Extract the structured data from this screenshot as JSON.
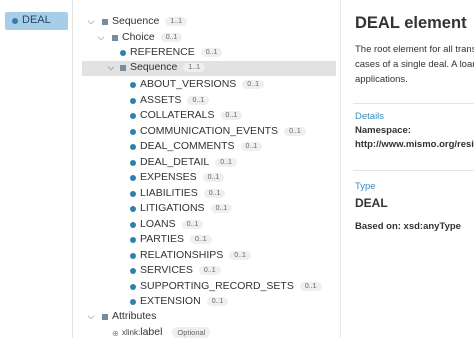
{
  "root_item": {
    "label": "DEAL"
  },
  "tree": {
    "sequence": {
      "label": "Sequence",
      "card": "1..1"
    },
    "choice": {
      "label": "Choice",
      "card": "0..1"
    },
    "reference": {
      "label": "REFERENCE",
      "card": "0..1"
    },
    "inner_sequence": {
      "label": "Sequence",
      "card": "1..1"
    },
    "elements": [
      {
        "label": "ABOUT_VERSIONS",
        "card": "0..1"
      },
      {
        "label": "ASSETS",
        "card": "0..1"
      },
      {
        "label": "COLLATERALS",
        "card": "0..1"
      },
      {
        "label": "COMMUNICATION_EVENTS",
        "card": "0..1"
      },
      {
        "label": "DEAL_COMMENTS",
        "card": "0..1"
      },
      {
        "label": "DEAL_DETAIL",
        "card": "0..1"
      },
      {
        "label": "EXPENSES",
        "card": "0..1"
      },
      {
        "label": "LIABILITIES",
        "card": "0..1"
      },
      {
        "label": "LITIGATIONS",
        "card": "0..1"
      },
      {
        "label": "LOANS",
        "card": "0..1"
      },
      {
        "label": "PARTIES",
        "card": "0..1"
      },
      {
        "label": "RELATIONSHIPS",
        "card": "0..1"
      },
      {
        "label": "SERVICES",
        "card": "0..1"
      },
      {
        "label": "SUPPORTING_RECORD_SETS",
        "card": "0..1"
      },
      {
        "label": "EXTENSION",
        "card": "0..1"
      }
    ],
    "attributes": {
      "label": "Attributes"
    },
    "xlink_label": {
      "prefix": "xlink:",
      "name": "label",
      "optional": "Optional"
    }
  },
  "details": {
    "title": "DEAL element",
    "description": "The root element for all trans use cases of a single deal. A loans or loan applications.",
    "details_label": "Details",
    "namespace_label": "Namespace:",
    "namespace_value": "http://www.mismo.org/resid",
    "type_label": "Type",
    "type_value": "DEAL",
    "based_on": "Based on: xsd:anyType"
  }
}
